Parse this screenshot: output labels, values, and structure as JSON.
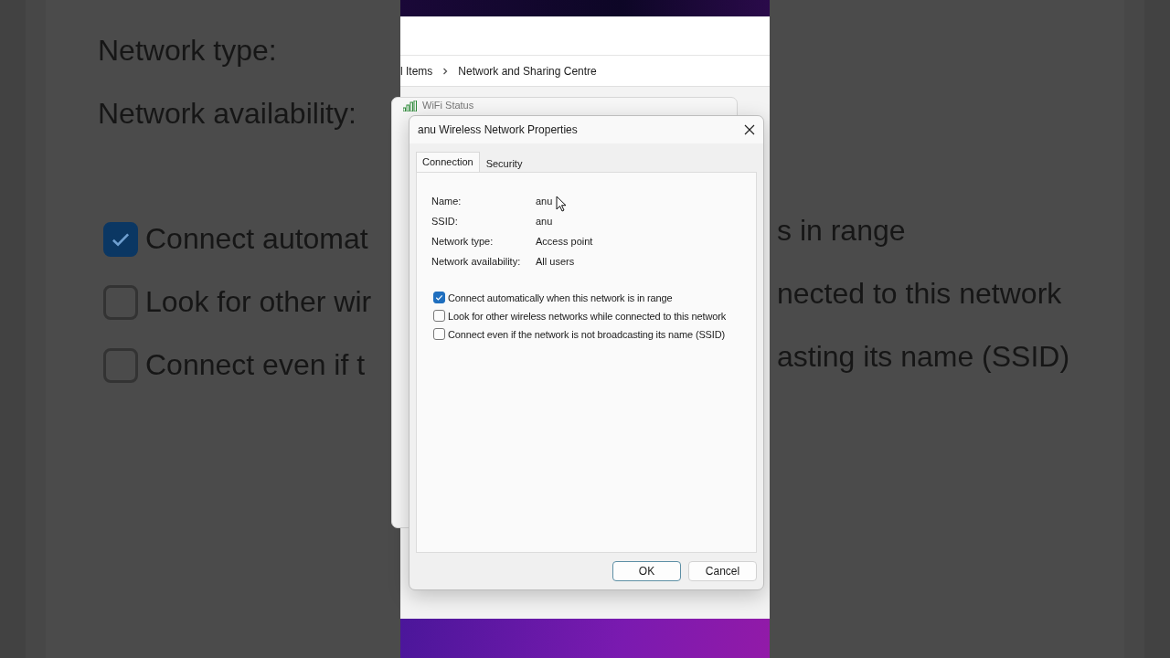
{
  "backdrop": {
    "left": {
      "labels": [
        "Network type:",
        "Network availability:"
      ],
      "checkboxes": [
        {
          "label": "Connect automat",
          "checked": true
        },
        {
          "label": "Look for other wir",
          "checked": false
        },
        {
          "label": "Connect even if t",
          "checked": false
        }
      ]
    },
    "right": {
      "lines": [
        "s in range",
        "nected to this network",
        "asting its name (SSID)"
      ]
    }
  },
  "explorer": {
    "breadcrumb": [
      "l Items",
      "Network and Sharing Centre"
    ]
  },
  "behind_window": {
    "title": "WiFi Status"
  },
  "dialog": {
    "title": "anu Wireless Network Properties",
    "tabs": [
      {
        "label": "Connection",
        "selected": true
      },
      {
        "label": "Security",
        "selected": false
      }
    ],
    "fields": [
      {
        "label": "Name:",
        "value": "anu"
      },
      {
        "label": "SSID:",
        "value": "anu"
      },
      {
        "label": "Network type:",
        "value": "Access point"
      },
      {
        "label": "Network availability:",
        "value": "All users"
      }
    ],
    "checkboxes": [
      {
        "label": "Connect automatically when this network is in range",
        "checked": true
      },
      {
        "label": "Look for other wireless networks while connected to this network",
        "checked": false
      },
      {
        "label": "Connect even if the network is not broadcasting its name (SSID)",
        "checked": false
      }
    ],
    "buttons": [
      {
        "label": "OK",
        "kind": "default"
      },
      {
        "label": "Cancel",
        "kind": "normal"
      }
    ]
  }
}
